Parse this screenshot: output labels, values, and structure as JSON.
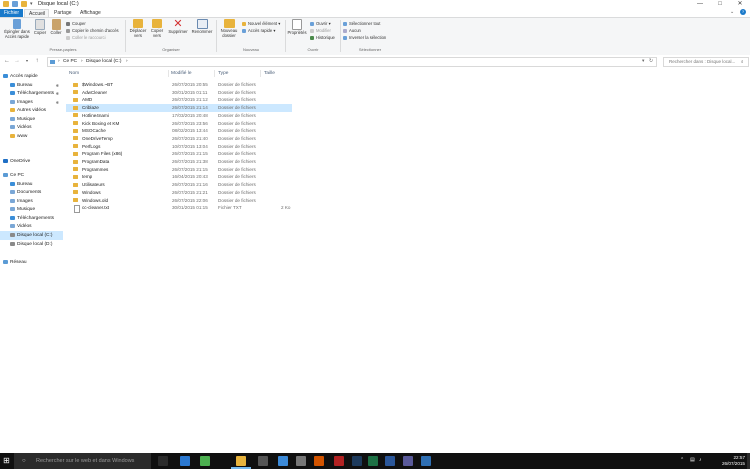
{
  "window": {
    "title": "Disque local (C:)",
    "minimize_glyph": "—",
    "maximize_glyph": "□",
    "close_glyph": "✕"
  },
  "ribbon_tabs": [
    {
      "label": "Fichier"
    },
    {
      "label": "Accueil"
    },
    {
      "label": "Partage"
    },
    {
      "label": "Affichage"
    }
  ],
  "ribbon": {
    "pin_label": "Épingler dans Accès rapide",
    "copy_label": "Copier",
    "paste_label": "Coller",
    "cut_label": "Couper",
    "copy_path_label": "Copier le chemin d'accès",
    "paste_shortcut_label": "Coller le raccourci",
    "clipboard_group": "Presse-papiers",
    "move_label": "Déplacer vers",
    "copy_to_label": "Copier vers",
    "delete_label": "Supprimer",
    "rename_label": "Renommer",
    "organize_group": "Organiser",
    "new_folder_label": "Nouveau dossier",
    "new_item_label": "Nouvel élément",
    "easy_access_label": "Accès rapide",
    "new_group": "Nouveau",
    "properties_label": "Propriétés",
    "open_label": "Ouvrir",
    "edit_label": "Modifier",
    "history_label": "Historique",
    "open_group": "Ouvrir",
    "select_all_label": "Sélectionner tout",
    "select_none_label": "Aucun",
    "invert_selection_label": "Inverser la sélection",
    "select_group": "Sélectionner"
  },
  "address": {
    "back": "←",
    "forward": "→",
    "up": "↑",
    "path_root": "Ce PC",
    "path_current": "Disque local (C:)",
    "separator": "›",
    "search_placeholder": "Rechercher dans : Disque local..."
  },
  "nav_pane": [
    {
      "label": "Accès rapide",
      "icon": "star-icon",
      "color": "#3b8ed8",
      "level": 0
    },
    {
      "label": "Bureau",
      "icon": "desktop-icon",
      "color": "#3b8ed8",
      "level": 1,
      "pinned": true
    },
    {
      "label": "Téléchargements",
      "icon": "download-icon",
      "color": "#3b8ed8",
      "level": 1,
      "pinned": true
    },
    {
      "label": "Images",
      "icon": "pictures-icon",
      "color": "#7aa7d6",
      "level": 1,
      "pinned": true
    },
    {
      "label": "Autres vidéos",
      "icon": "folder-icon",
      "color": "#e8b33c",
      "level": 1
    },
    {
      "label": "Musique",
      "icon": "music-icon",
      "color": "#7aa7d6",
      "level": 1
    },
    {
      "label": "Vidéos",
      "icon": "videos-icon",
      "color": "#7aa7d6",
      "level": 1
    },
    {
      "label": "www",
      "icon": "folder-icon",
      "color": "#e8b33c",
      "level": 1
    },
    {
      "label": "OneDrive",
      "icon": "cloud-icon",
      "color": "#1f6fc5",
      "level": 0
    },
    {
      "label": "Ce PC",
      "icon": "computer-icon",
      "color": "#5b9bd5",
      "level": 0
    },
    {
      "label": "Bureau",
      "icon": "desktop-icon",
      "color": "#3b8ed8",
      "level": 1
    },
    {
      "label": "Documents",
      "icon": "documents-icon",
      "color": "#7aa7d6",
      "level": 1
    },
    {
      "label": "Images",
      "icon": "pictures-icon",
      "color": "#7aa7d6",
      "level": 1
    },
    {
      "label": "Musique",
      "icon": "music-icon",
      "color": "#7aa7d6",
      "level": 1
    },
    {
      "label": "Téléchargements",
      "icon": "download-icon",
      "color": "#3b8ed8",
      "level": 1
    },
    {
      "label": "Vidéos",
      "icon": "videos-icon",
      "color": "#7aa7d6",
      "level": 1
    },
    {
      "label": "Disque local (C:)",
      "icon": "drive-icon",
      "color": "#8a8a8a",
      "level": 1,
      "selected": true
    },
    {
      "label": "Disque local (D:)",
      "icon": "drive-icon",
      "color": "#8a8a8a",
      "level": 1
    },
    {
      "label": "Réseau",
      "icon": "network-icon",
      "color": "#5b9bd5",
      "level": 0
    }
  ],
  "columns": {
    "name": "Nom",
    "date": "Modifié le",
    "type": "Type",
    "size": "Taille"
  },
  "files": [
    {
      "name": "$Windows.~BT",
      "date": "26/07/2015 20:55",
      "type": "Dossier de fichiers",
      "size": "",
      "kind": "folder"
    },
    {
      "name": "AdwCleaner",
      "date": "30/01/2015 01:11",
      "type": "Dossier de fichiers",
      "size": "",
      "kind": "folder"
    },
    {
      "name": "AMD",
      "date": "26/07/2015 21:12",
      "type": "Dossier de fichiers",
      "size": "",
      "kind": "folder"
    },
    {
      "name": "Criblaze",
      "date": "26/07/2015 21:14",
      "type": "Dossier de fichiers",
      "size": "",
      "kind": "folder",
      "selected": true
    },
    {
      "name": "Hotline4nami",
      "date": "17/03/2015 20:48",
      "type": "Dossier de fichiers",
      "size": "",
      "kind": "folder"
    },
    {
      "name": "Kick Boxing et KM",
      "date": "26/07/2015 23:56",
      "type": "Dossier de fichiers",
      "size": "",
      "kind": "folder"
    },
    {
      "name": "MSOCache",
      "date": "08/02/2015 13:44",
      "type": "Dossier de fichiers",
      "size": "",
      "kind": "folder"
    },
    {
      "name": "OneDriveTemp",
      "date": "26/07/2015 21:40",
      "type": "Dossier de fichiers",
      "size": "",
      "kind": "folder"
    },
    {
      "name": "PerfLogs",
      "date": "10/07/2015 13:04",
      "type": "Dossier de fichiers",
      "size": "",
      "kind": "folder"
    },
    {
      "name": "Program Files (x86)",
      "date": "26/07/2015 21:15",
      "type": "Dossier de fichiers",
      "size": "",
      "kind": "folder"
    },
    {
      "name": "ProgramData",
      "date": "26/07/2015 21:38",
      "type": "Dossier de fichiers",
      "size": "",
      "kind": "folder"
    },
    {
      "name": "Programmes",
      "date": "26/07/2015 21:15",
      "type": "Dossier de fichiers",
      "size": "",
      "kind": "folder"
    },
    {
      "name": "temp",
      "date": "16/04/2015 20:43",
      "type": "Dossier de fichiers",
      "size": "",
      "kind": "folder"
    },
    {
      "name": "Utilisateurs",
      "date": "26/07/2015 21:16",
      "type": "Dossier de fichiers",
      "size": "",
      "kind": "folder"
    },
    {
      "name": "Windows",
      "date": "26/07/2015 21:21",
      "type": "Dossier de fichiers",
      "size": "",
      "kind": "folder"
    },
    {
      "name": "Windows.old",
      "date": "26/07/2015 22:06",
      "type": "Dossier de fichiers",
      "size": "",
      "kind": "folder"
    },
    {
      "name": "cc-cleaner.txt",
      "date": "30/01/2015 01:15",
      "type": "Fichier TXT",
      "size": "2 Ko",
      "kind": "file"
    }
  ],
  "taskbar": {
    "search_placeholder": "Rechercher sur le web et dans Windows",
    "time": "22:57",
    "date": "26/07/2015",
    "apps": [
      {
        "name": "task-view-icon",
        "color": "#2b2b2b"
      },
      {
        "name": "edge-icon",
        "color": "#2b78d0"
      },
      {
        "name": "chrome-icon",
        "color": "#4caf50"
      },
      {
        "name": "file-explorer-icon",
        "color": "#e8b33c"
      },
      {
        "name": "calculator-icon",
        "color": "#555555"
      },
      {
        "name": "store-icon",
        "color": "#3c8ad8"
      },
      {
        "name": "settings-icon",
        "color": "#777777"
      },
      {
        "name": "office-icon",
        "color": "#d35400"
      },
      {
        "name": "filezilla-icon",
        "color": "#b22222"
      },
      {
        "name": "photoshop-icon",
        "color": "#1d3a5c"
      },
      {
        "name": "excel-icon",
        "color": "#1e7145"
      },
      {
        "name": "word-icon",
        "color": "#2b579a"
      },
      {
        "name": "media-icon",
        "color": "#5a5a9a"
      },
      {
        "name": "misc-app-icon",
        "color": "#2f6fb3"
      }
    ]
  }
}
